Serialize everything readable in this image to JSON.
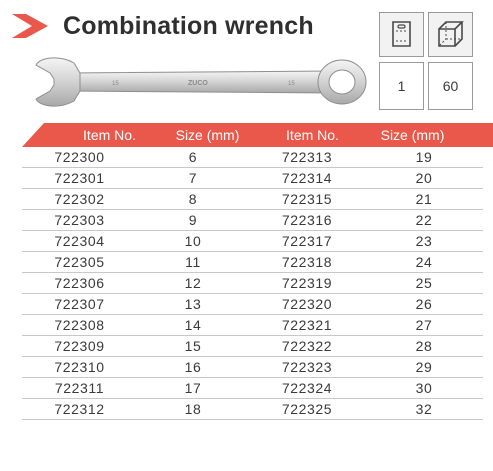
{
  "title": "Combination wrench",
  "brand_color": "#e9584a",
  "wrench_engraving": {
    "left_size": "15",
    "brand": "ZUCO",
    "right_size": "15"
  },
  "packaging": {
    "icons": [
      "hang-card-icon",
      "box-icon"
    ],
    "values": [
      "1",
      "60"
    ]
  },
  "table": {
    "headers": [
      "Item No.",
      "Size (mm)",
      "Item No.",
      "Size (mm)"
    ],
    "rows": [
      [
        "722300",
        "6",
        "722313",
        "19"
      ],
      [
        "722301",
        "7",
        "722314",
        "20"
      ],
      [
        "722302",
        "8",
        "722315",
        "21"
      ],
      [
        "722303",
        "9",
        "722316",
        "22"
      ],
      [
        "722304",
        "10",
        "722317",
        "23"
      ],
      [
        "722305",
        "11",
        "722318",
        "24"
      ],
      [
        "722306",
        "12",
        "722319",
        "25"
      ],
      [
        "722307",
        "13",
        "722320",
        "26"
      ],
      [
        "722308",
        "14",
        "722321",
        "27"
      ],
      [
        "722309",
        "15",
        "722322",
        "28"
      ],
      [
        "722310",
        "16",
        "722323",
        "29"
      ],
      [
        "722311",
        "17",
        "722324",
        "30"
      ],
      [
        "722312",
        "18",
        "722325",
        "32"
      ]
    ]
  }
}
